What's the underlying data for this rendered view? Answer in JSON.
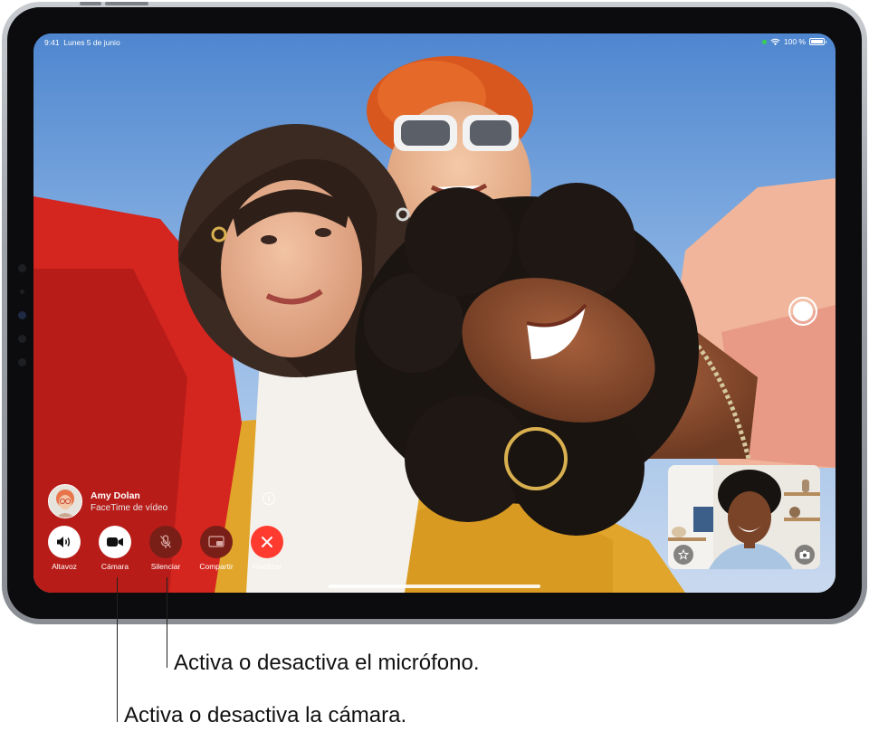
{
  "status_bar": {
    "time": "9:41",
    "date": "Lunes 5 de junio",
    "battery": "100 %"
  },
  "caller": {
    "name": "Amy Dolan",
    "subtitle": "FaceTime de vídeo"
  },
  "info_glyph": "i",
  "controls": [
    {
      "id": "speaker",
      "label": "Altavoz",
      "icon": "speaker-icon",
      "style": "white"
    },
    {
      "id": "camera",
      "label": "Cámara",
      "icon": "video-camera-icon",
      "style": "white"
    },
    {
      "id": "mute",
      "label": "Silenciar",
      "icon": "microphone-slash-icon",
      "style": "dark-red"
    },
    {
      "id": "share",
      "label": "Compartir",
      "icon": "share-screen-icon",
      "style": "dark-red"
    },
    {
      "id": "end",
      "label": "Finalizar",
      "icon": "close-icon",
      "style": "red"
    }
  ],
  "callouts": {
    "microphone": "Activa o desactiva el micrófono.",
    "camera": "Activa o desactiva la cámara."
  },
  "colors": {
    "end_call": "#ff3b30",
    "dark_button": "#7a1f18",
    "sky": "#8fb5e4",
    "status_green": "#3ad04f"
  },
  "icons": {
    "wifi": "wifi-icon",
    "battery": "battery-icon",
    "shutter": "shutter-button-icon",
    "effects": "star-effects-icon",
    "flip_camera": "flip-camera-icon",
    "info": "info-icon"
  }
}
